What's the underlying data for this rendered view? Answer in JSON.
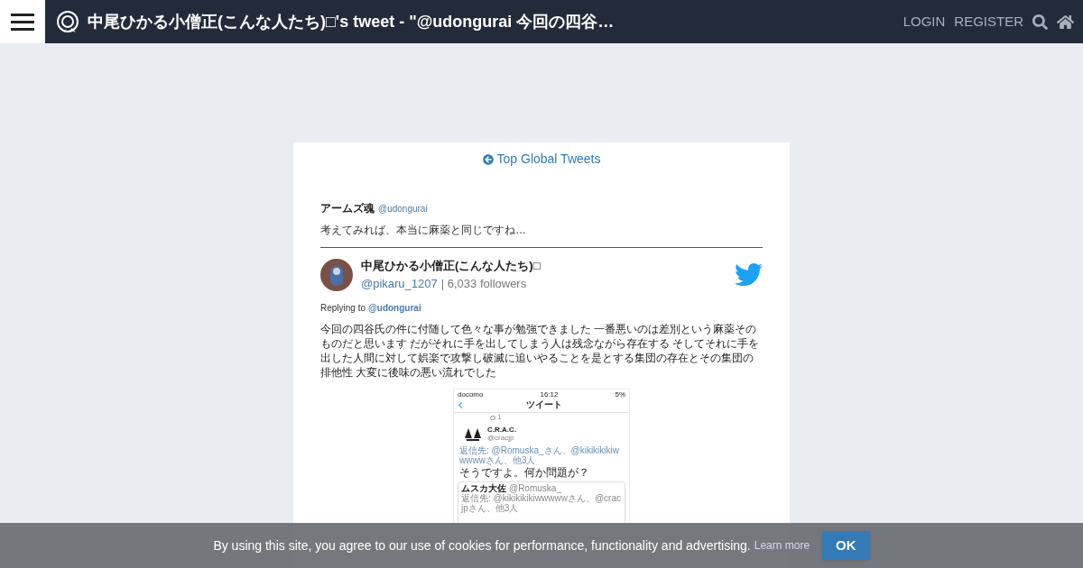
{
  "header": {
    "title": "中尾ひかる小僧正(こんな人たち)□'s tweet - \"@udongurai 今回の四谷…",
    "links": [
      "LOGIN",
      "REGISTER"
    ]
  },
  "back_link": "Top Global Tweets",
  "quoted": {
    "name": "アームズ魂",
    "handle": "@udongurai",
    "text": "考えてみれば、本当に麻薬と同じですね…"
  },
  "tweet": {
    "name": "中尾ひかる小僧正(こんな人たち)□",
    "handle": "@pikaru_1207",
    "followers": "| 6,033 followers",
    "replying_label": "Replying to",
    "replying_to": "@udongurai",
    "text": "今回の四谷氏の件に付随して色々な事が勉強できました 一番悪いのは差別という麻薬そのものだと思います だがそれに手を出してしまう人は残念ながら存在する そしてそれに手を出した人間に対して娯楽で攻撃し破滅に追いやることを是とする集団の存在とその集団の排他性 大変に後味の悪い流れでした"
  },
  "attached_screenshot": {
    "carrier": "docomo",
    "time": "16:12",
    "battery": "5%",
    "screen_title": "ツイート",
    "reply_count": "1",
    "account_name": "C.R.A.C.",
    "account_handle": "@cracjp",
    "reply_to": "返信先: @Romuska_さん、@kikikikikiwwwwwさん、他3人",
    "post": "そうですよ。何か問題が？",
    "quote_name": "ムスカ大佐",
    "quote_handle": "@Romuska_",
    "quote_reply_to": "返信先: @kikikikikiwwwwwさん、@cracjpさん、他3人"
  },
  "cookie_bar": {
    "text": "By using this site, you agree to our use of cookies for performance, functionality and advertising.",
    "link": "Learn more",
    "button": "OK"
  }
}
